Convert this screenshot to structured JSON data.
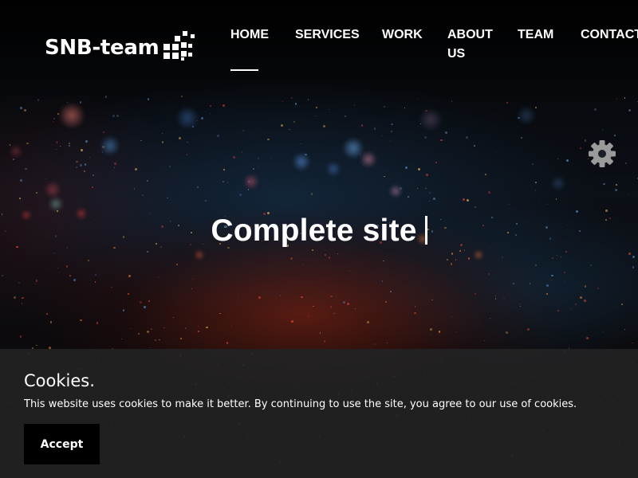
{
  "header": {
    "logo_text": "SNB-team",
    "nav": [
      {
        "label": "HOME",
        "active": true
      },
      {
        "label": "SERVICES"
      },
      {
        "label": "WORK"
      },
      {
        "label": "ABOUT US"
      },
      {
        "label": "TEAM"
      },
      {
        "label": "CONTACT"
      }
    ]
  },
  "hero": {
    "title": "Complete site",
    "settings_icon": "gear-icon"
  },
  "cookie_banner": {
    "title": "Cookies.",
    "text": "This website uses cookies to make it better. By continuing to use the site, you agree to our use of cookies.",
    "accept_label": "Accept"
  },
  "colors": {
    "background": "#050608",
    "banner": "#222224",
    "button": "#000000",
    "text": "#ffffff",
    "gear": "#9a9a9a"
  }
}
